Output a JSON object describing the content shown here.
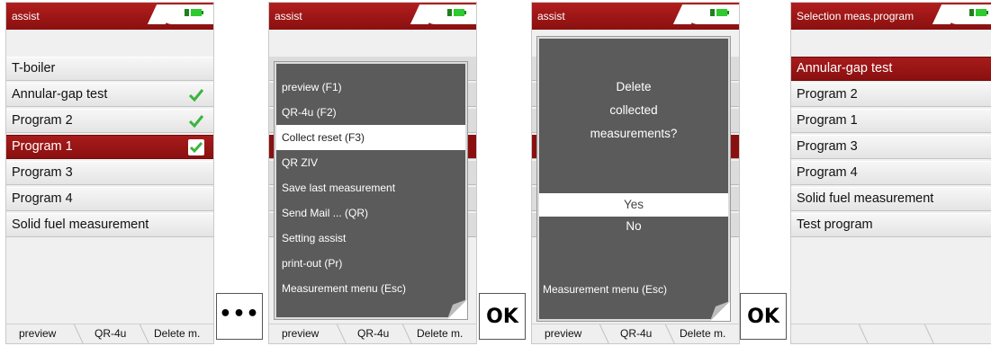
{
  "screens": [
    {
      "title": "assist",
      "items": [
        {
          "label": "T-boiler",
          "checked": false
        },
        {
          "label": "Annular-gap test",
          "checked": true
        },
        {
          "label": "Program 2",
          "checked": true
        },
        {
          "label": "Program 1",
          "checked": true,
          "selected": true
        },
        {
          "label": "Program 3",
          "checked": false
        },
        {
          "label": "Program 4",
          "checked": false
        },
        {
          "label": "Solid fuel measurement",
          "checked": false
        }
      ],
      "softkeys": [
        "preview",
        "QR-4u",
        "Delete m."
      ]
    },
    {
      "title": "assist",
      "menu": [
        "preview (F1)",
        "QR-4u (F2)",
        "Collect reset (F3)",
        "QR ZIV",
        "Save last measurement",
        "Send Mail ... (QR)",
        "Setting assist",
        "print-out (Pr)",
        "Measurement menu (Esc)"
      ],
      "highlighted_index": 2,
      "softkeys": [
        "preview",
        "QR-4u",
        "Delete m."
      ]
    },
    {
      "title": "assist",
      "dialog": {
        "lines": [
          "Delete",
          "collected",
          "measurements?"
        ],
        "options": [
          "Yes",
          "No"
        ],
        "highlighted": "Yes",
        "footer": "Measurement menu (Esc)"
      },
      "softkeys": [
        "preview",
        "QR-4u",
        "Delete m."
      ]
    },
    {
      "title": "Selection meas.program",
      "items": [
        {
          "label": "Annular-gap test",
          "selected": true
        },
        {
          "label": "Program 2"
        },
        {
          "label": "Program 1"
        },
        {
          "label": "Program 3"
        },
        {
          "label": "Program 4"
        },
        {
          "label": "Solid fuel measurement"
        },
        {
          "label": "Test program"
        }
      ],
      "softkeys": [
        "",
        "",
        ""
      ]
    }
  ],
  "operators": [
    "•••",
    "OK",
    "OK"
  ],
  "colors": {
    "titlebar": "#9e1616",
    "selected_row": "#9a1414",
    "check": "#3cb43c",
    "popup": "#5b5b5b",
    "battery": "#2eca2e"
  },
  "icons": {
    "checkmark": "check-icon",
    "battery": "battery-icon"
  }
}
